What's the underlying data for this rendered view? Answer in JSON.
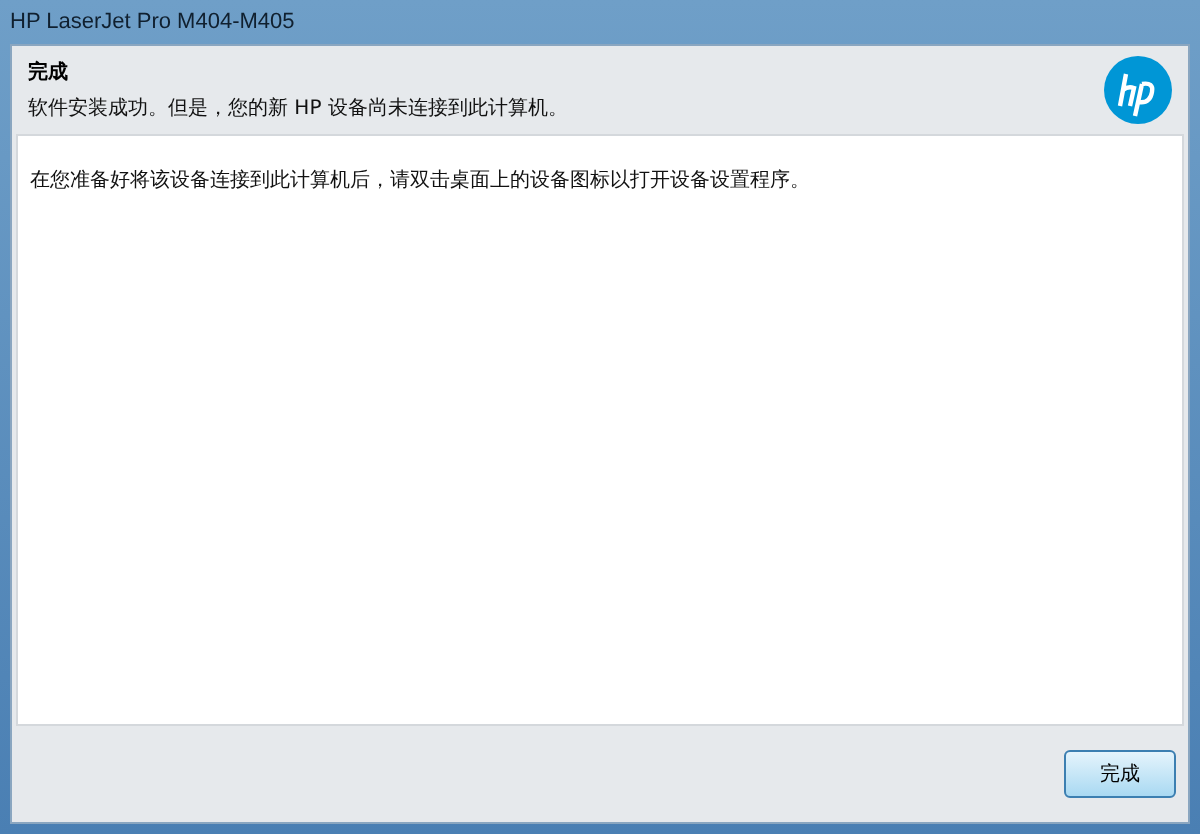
{
  "window": {
    "title": "HP LaserJet Pro M404-M405"
  },
  "header": {
    "title": "完成",
    "subtitle": "软件安装成功。但是，您的新 HP 设备尚未连接到此计算机。"
  },
  "content": {
    "message": "在您准备好将该设备连接到此计算机后，请双击桌面上的设备图标以打开设备设置程序。"
  },
  "buttons": [
    {
      "label": "完成",
      "selected": true
    }
  ]
}
